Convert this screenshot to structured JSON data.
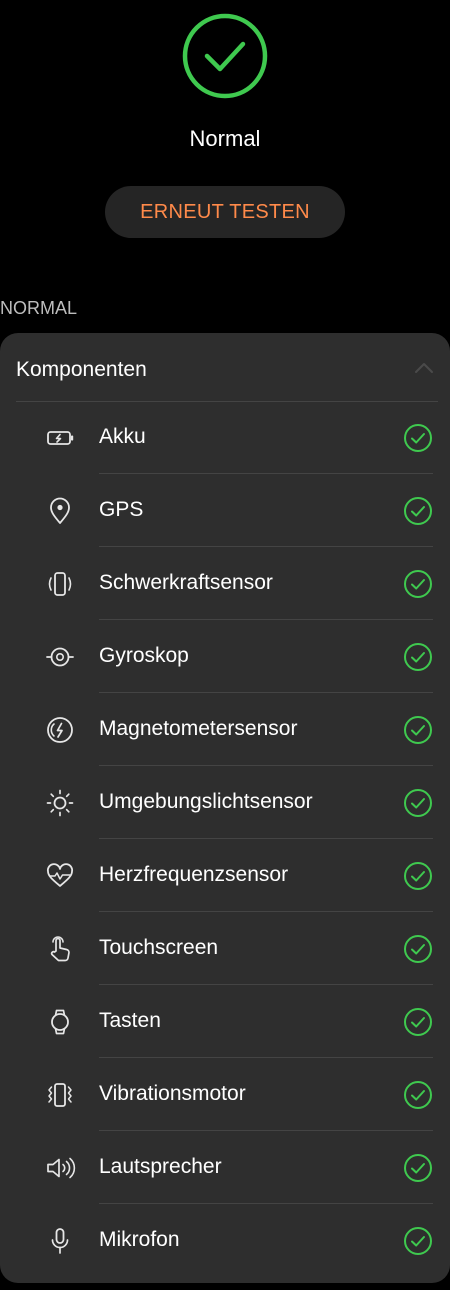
{
  "status": {
    "icon": "check-circle-icon",
    "text": "Normal",
    "color": "#3fc94f"
  },
  "retest_button": {
    "label": "ERNEUT TESTEN",
    "color": "#ff8a4a"
  },
  "section": {
    "label": "NORMAL"
  },
  "components": {
    "title": "Komponenten",
    "collapse_icon": "chevron-up-icon",
    "items": [
      {
        "label": "Akku",
        "icon": "battery-icon",
        "status": "pass"
      },
      {
        "label": "GPS",
        "icon": "location-pin-icon",
        "status": "pass"
      },
      {
        "label": "Schwerkraftsensor",
        "icon": "device-rotate-icon",
        "status": "pass"
      },
      {
        "label": "Gyroskop",
        "icon": "gyroscope-icon",
        "status": "pass"
      },
      {
        "label": "Magnetometersensor",
        "icon": "magnetometer-icon",
        "status": "pass"
      },
      {
        "label": "Umgebungslichtsensor",
        "icon": "sun-icon",
        "status": "pass"
      },
      {
        "label": "Herzfrequenzsensor",
        "icon": "heart-rate-icon",
        "status": "pass"
      },
      {
        "label": "Touchscreen",
        "icon": "touch-hand-icon",
        "status": "pass"
      },
      {
        "label": "Tasten",
        "icon": "watch-icon",
        "status": "pass"
      },
      {
        "label": "Vibrationsmotor",
        "icon": "vibration-icon",
        "status": "pass"
      },
      {
        "label": "Lautsprecher",
        "icon": "speaker-icon",
        "status": "pass"
      },
      {
        "label": "Mikrofon",
        "icon": "microphone-icon",
        "status": "pass"
      }
    ]
  }
}
